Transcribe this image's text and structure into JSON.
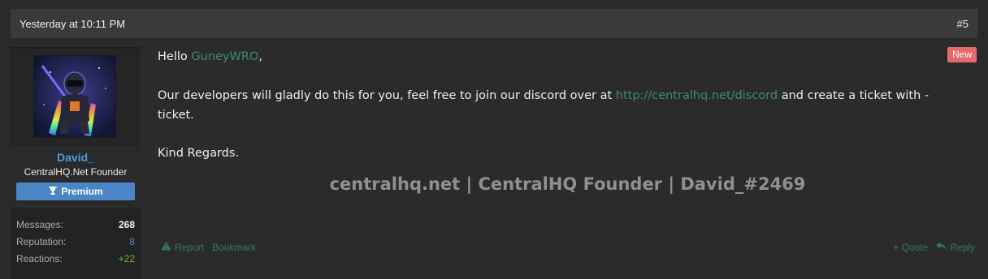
{
  "post": {
    "timestamp": "Yesterday at 10:11 PM",
    "number": "#5",
    "new_label": "New"
  },
  "user": {
    "name": "David_",
    "title": "CentralHQ.Net Founder",
    "badge": "Premium",
    "stats": [
      {
        "label": "Messages:",
        "value": "268"
      },
      {
        "label": "Reputation:",
        "value": "8"
      },
      {
        "label": "Reactions:",
        "value": "+22"
      }
    ]
  },
  "message": {
    "greeting": "Hello ",
    "mention": "GuneyWRO",
    "greeting_end": ",",
    "line2_a": "Our developers will gladly do this for you, feel free to join our discord over at ",
    "line2_link": "http://centralhq.net/discord",
    "line2_b": " and create a ticket with -",
    "line2_c": "ticket.",
    "closing": "Kind Regards."
  },
  "signature": "centralhq.net | CentralHQ Founder | David_#2469",
  "actions": {
    "report": "Report",
    "bookmark": "Bookmark",
    "quote": "+ Quote",
    "reply": "Reply"
  },
  "colors": {
    "accent_link": "#3b8b79",
    "username": "#4a9be0",
    "badge": "#4a86c6",
    "new": "#e76a6a"
  }
}
